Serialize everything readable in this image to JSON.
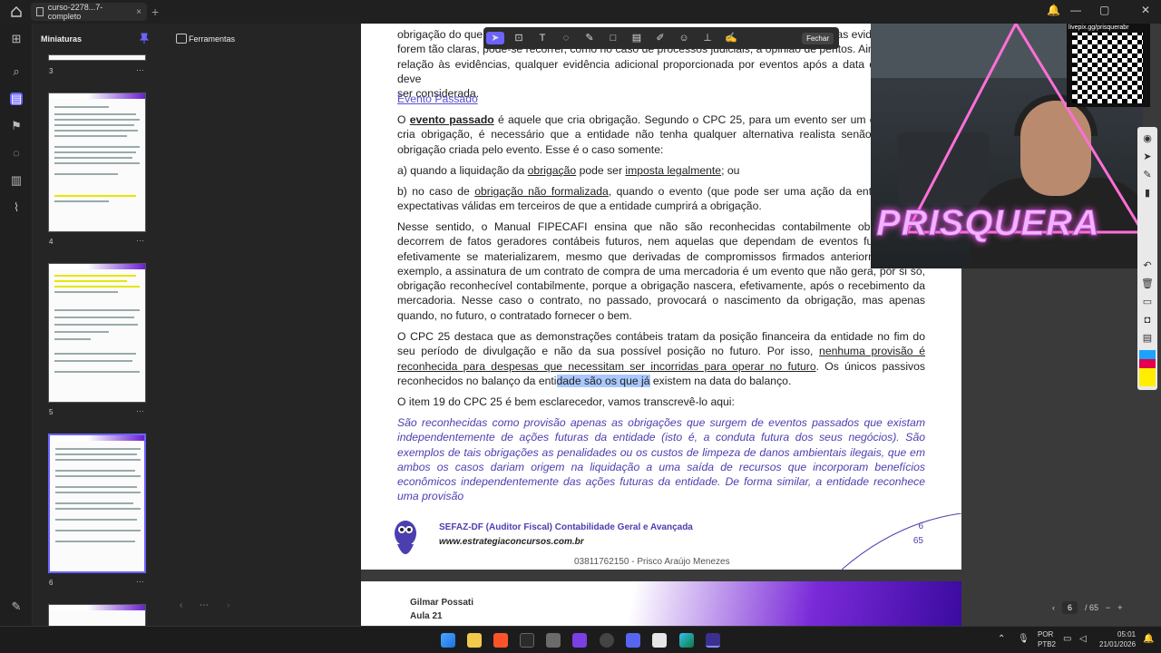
{
  "window": {
    "tab_title": "curso-2278...7-completo"
  },
  "sidebar": {
    "thumbnails_label": "Miniaturas",
    "page_numbers": [
      "3",
      "4",
      "5",
      "6"
    ],
    "tools_label": "Ferramentas"
  },
  "annotation_toolbar": {
    "close_label": "Fechar"
  },
  "document": {
    "top_paragraph": "obrigação do que ... forem tão claras, pode-se recorrer, como no caso de processos judiciais, à opinião de peritos. Ainda com relação às evidências, qualquer evidência adicional proporcionada por eventos após a data do balanço deve ser considerada.",
    "top_line1": "obrigação do que",
    "top_line1_end": "as evidências não",
    "top_line2": "forem tão claras, pode-se recorrer, como no caso de processos judiciais, à opinião de peritos. Ainda com",
    "top_line3": "relação às evidências, qualquer evidência adicional proporcionada por eventos após a data do balanço deve",
    "top_line4": "ser considerada.",
    "heading": "Evento Passado",
    "p1_pre": "O ",
    "p1_bold": "evento passado",
    "p1_rest": " é aquele que cria obrigação. Segundo o CPC 25, para um evento ser um evento que cria obrigação, é necessário que a entidade não tenha qualquer alternativa realista senão liquidar a obrigação criada pelo evento. Esse é o caso somente:",
    "item_a_pre": "a) quando a liquidação da ",
    "item_a_u1": "obrigação",
    "item_a_mid": " pode ser ",
    "item_a_u2": "imposta legalmente",
    "item_a_end": "; ou",
    "item_b_pre": "b)        no caso de ",
    "item_b_u": "obrigação não formalizada",
    "item_b_rest": ", quando o evento (que pode ser uma ação da entidade) cria expectativas válidas em terceiros de que a entidade cumprirá a obrigação.",
    "p2": "Nesse sentido, o Manual FIPECAFI ensina que não são reconhecidas contabilmente obrigações a decorrem de fatos geradores contábeis futuros, nem aquelas que dependam de eventos futuros para efetivamente se materializarem, mesmo que derivadas de compromissos firmados anteriormente. Por exemplo, a assinatura de um contrato de compra de uma mercadoria é um evento que não gera, por si só, obrigação reconhecível contabilmente, porque a obrigação nascera, efetivamente, após o recebimento da mercadoria. Nesse caso o contrato, no passado, provocará o nascimento da obrigação, mas apenas quando, no futuro, o contratado fornecer o bem.",
    "p3_pre": "O CPC 25 destaca que as demonstrações contábeis tratam da posição financeira da entidade no fim do seu período de divulgação e não da sua possível posição no futuro. Por isso, ",
    "p3_u": "nenhuma provisão é reconhecida para despesas que necessitam ser incorridas para operar no futuro",
    "p3_mid": ". Os únicos passivos reconhecidos no balanço da enti",
    "p3_hl": "dade são os que já",
    "p3_end": " existem na data do balanço.",
    "p4": "O item 19 do CPC 25 é bem esclarecedor, vamos transcrevê-lo aqui:",
    "quote": "São reconhecidas como provisão apenas as obrigações que surgem de eventos passados que existam independentemente de ações futuras da entidade (isto é, a conduta futura dos seus negócios). São exemplos de tais obrigações as penalidades ou os custos de limpeza de danos ambientais ilegais, que em ambos os casos dariam origem na liquidação a uma saída de recursos que incorporam benefícios econômicos independentemente das ações futuras da entidade. De forma similar, a entidade reconhece uma provisão",
    "footer_title": "SEFAZ-DF (Auditor Fiscal) Contabilidade Geral e Avançada",
    "footer_url": "www.estrategiaconcursos.com.br",
    "footer_page": "6",
    "footer_total": "65",
    "footer_id": "03811762150 - Prisco Araújo Menezes",
    "next_author": "Gilmar Possati",
    "next_lesson": "Aula 21"
  },
  "pagebar": {
    "current": "6",
    "total": "/ 65"
  },
  "overlay": {
    "qr_label": "livepix.gg/prisquerabr",
    "brand": "PRISQUERA"
  },
  "taskbar": {
    "lang": "POR",
    "kbd": "PTB2",
    "time": "05:01",
    "date": "21/01/2026"
  },
  "colors": {
    "accent": "#6c63ff",
    "link": "#5a4fcf",
    "brand_purple": "#4b3fb0"
  }
}
